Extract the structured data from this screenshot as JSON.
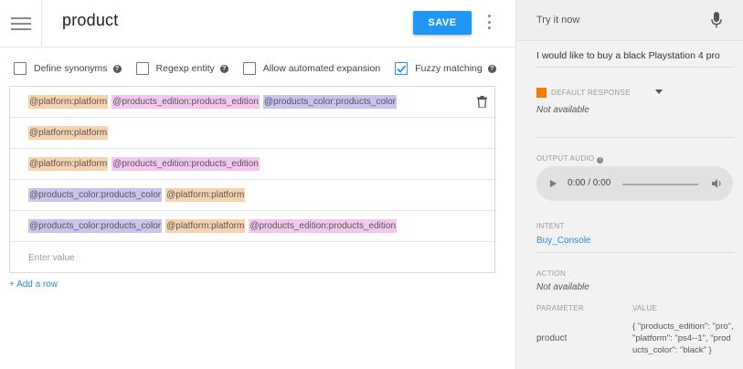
{
  "header": {
    "menu_icon": "hamburger-menu-icon",
    "entity_name": "product",
    "save_label": "SAVE",
    "more_icon": "more-vert-icon"
  },
  "options": [
    {
      "label": "Define synonyms",
      "checked": false,
      "help": "?"
    },
    {
      "label": "Regexp entity",
      "checked": false,
      "help": "?"
    },
    {
      "label": "Allow automated expansion",
      "checked": false
    },
    {
      "label": "Fuzzy matching",
      "checked": true,
      "help": "?"
    }
  ],
  "synonyms": {
    "rows": [
      [
        "@platform:platform",
        "@products_edition:products_edition",
        "@products_color:products_color"
      ],
      [
        "@platform:platform"
      ],
      [
        "@platform:platform",
        "@products_edition:products_edition"
      ],
      [
        "@products_color:products_color",
        "@platform:platform"
      ],
      [
        "@products_color:products_color",
        "@platform:platform",
        "@products_edition:products_edition"
      ]
    ],
    "placeholder": "Enter value",
    "delete_icon": "trash-icon"
  },
  "add_row_label": "+ Add a row",
  "try_panel": {
    "title": "Try it now",
    "mic_icon": "microphone-icon",
    "query": "I would like to buy a black Playstation 4 pro",
    "default_response_label": "DEFAULT RESPONSE",
    "default_response_value": "Not available",
    "output_audio_label": "OUTPUT AUDIO",
    "audio_time": "0:00 / 0:00",
    "intent_label": "INTENT",
    "intent_value": "Buy_Console",
    "action_label": "ACTION",
    "action_value": "Not available",
    "parameter_header": "PARAMETER",
    "value_header": "VALUE",
    "parameter_name": "product",
    "parameter_value": "{ \"products_edition\": \"pro\", \"platform\": \"ps4--1\", \"products_color\": \"black\" }"
  },
  "colors": {
    "accent": "#2196f3",
    "platform_chip": "#f8d3b0",
    "edition_chip": "#f3c8f0",
    "color_chip": "#c9c3ee",
    "response_icon": "#f57c00"
  }
}
